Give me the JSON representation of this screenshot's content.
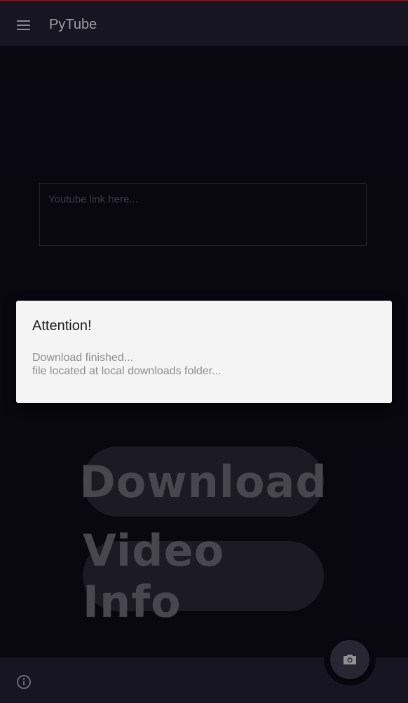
{
  "app": {
    "title": "PyTube"
  },
  "colors": {
    "accent_line": "#b3202b",
    "background": "#0e0c1a",
    "bar": "#232031",
    "dialog_bg": "#f4f4f4"
  },
  "icons": {
    "menu": "hamburger-icon",
    "info": "info-circle-icon",
    "fab": "camera-icon"
  },
  "input": {
    "placeholder": "Youtube link here...",
    "value": ""
  },
  "buttons": {
    "download_label": "Download",
    "info_label": "Video Info"
  },
  "dialog": {
    "title": "Attention!",
    "line1": "Download finished...",
    "line2": "file located at local downloads folder..."
  }
}
